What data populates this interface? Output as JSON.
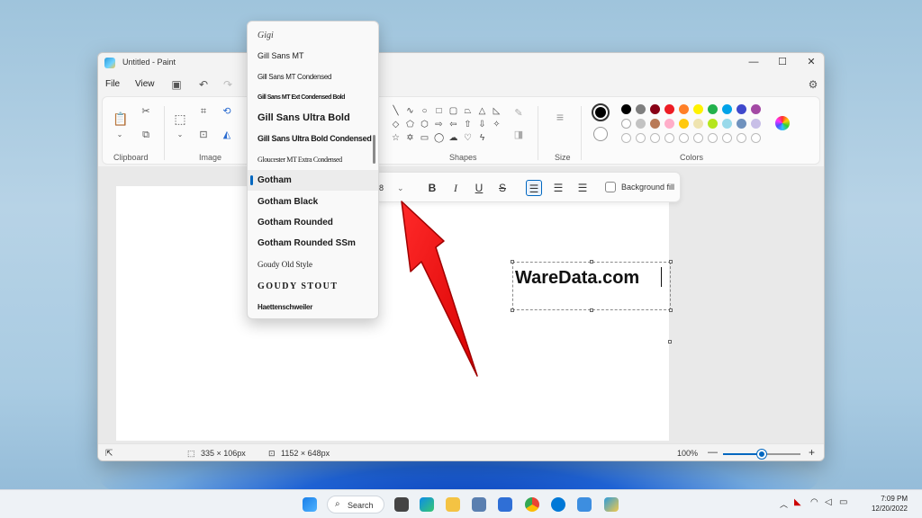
{
  "window": {
    "title": "Untitled - Paint",
    "minimize": "—",
    "maximize": "☐",
    "close": "✕"
  },
  "menu": {
    "file": "File",
    "view": "View"
  },
  "ribbon": {
    "groups": {
      "clipboard": "Clipboard",
      "image": "Image",
      "shapes": "Shapes",
      "size": "Size",
      "colors": "Colors"
    }
  },
  "colors": {
    "primary": "#000000",
    "secondary": "#ffffff",
    "accent": "#0067c0",
    "row1": [
      "#000000",
      "#7f7f7f",
      "#880015",
      "#ed1c24",
      "#ff7f27",
      "#fff200",
      "#22b14c",
      "#00a2e8",
      "#3f48cc",
      "#a349a4"
    ],
    "row2": [
      "#ffffff",
      "#c3c3c3",
      "#b97a57",
      "#ffaec9",
      "#ffc90e",
      "#efe4b0",
      "#b5e61d",
      "#99d9ea",
      "#7092be",
      "#c8bfe7"
    ]
  },
  "textbar": {
    "background_fill": "Background fill",
    "size_value": "8"
  },
  "font_list": {
    "items": [
      {
        "label": "Gigi"
      },
      {
        "label": "Gill Sans MT"
      },
      {
        "label": "Gill Sans MT Condensed"
      },
      {
        "label": "Gill Sans MT Ext Condensed Bold"
      },
      {
        "label": "Gill Sans Ultra Bold"
      },
      {
        "label": "Gill Sans Ultra Bold Condensed"
      },
      {
        "label": "Gloucester MT Extra Condensed"
      },
      {
        "label": "Gotham"
      },
      {
        "label": "Gotham Black"
      },
      {
        "label": "Gotham Rounded"
      },
      {
        "label": "Gotham Rounded SSm"
      },
      {
        "label": "Goudy Old Style"
      },
      {
        "label": "GOUDY STOUT"
      },
      {
        "label": "Haettenschweiler"
      }
    ],
    "selected": "Gotham"
  },
  "canvas_text": "WareData.com",
  "status": {
    "selection_size": "335 × 106px",
    "canvas_size": "1152 × 648px",
    "zoom": "100%",
    "zoom_fraction": 0.5
  },
  "taskbar": {
    "search": "Search",
    "time": "7:09 PM",
    "date": "12/20/2022"
  }
}
